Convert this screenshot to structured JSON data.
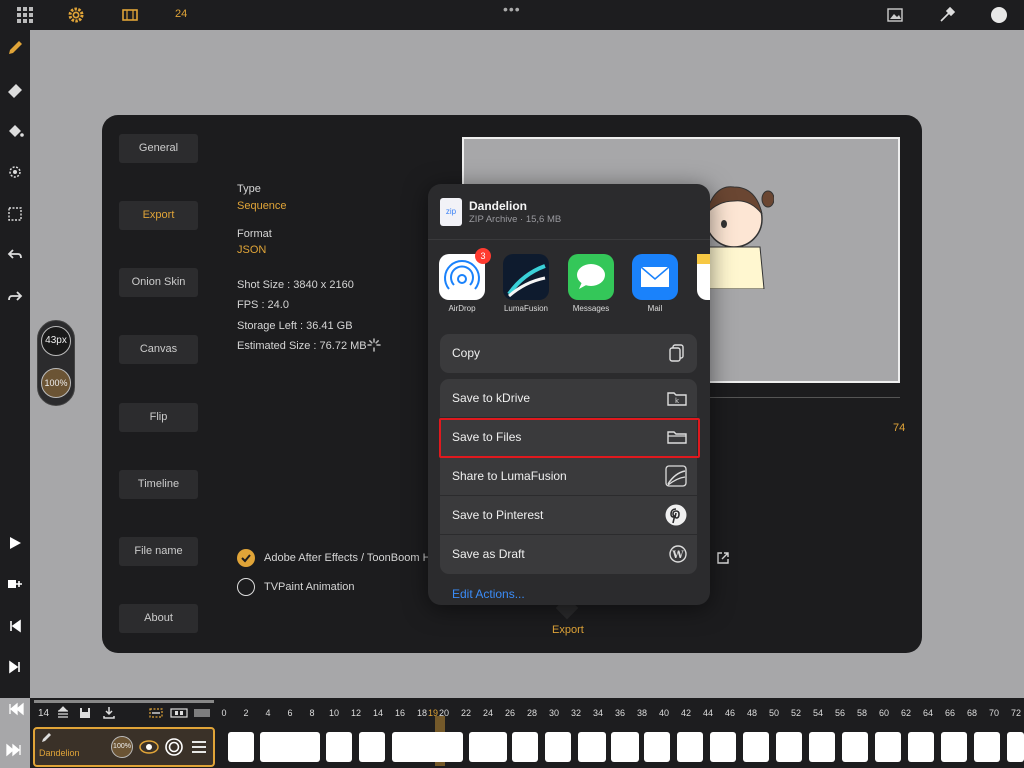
{
  "top_bar": {
    "frame_count": "24",
    "more_dots": "•••",
    "icons": [
      "grid-icon",
      "gear-icon",
      "film-icon",
      "image-icon",
      "eyedropper-icon",
      "color-swatch-icon"
    ]
  },
  "left_toolbar": {
    "tools": [
      "pencil-icon",
      "eraser-icon",
      "fill-bucket-icon",
      "lasso-icon",
      "selection-icon",
      "undo-icon",
      "redo-icon",
      "play-icon",
      "add-frame-icon",
      "first-frame-icon",
      "next-frame-icon",
      "skip-start-icon",
      "skip-end-icon"
    ],
    "brush_size": "43px",
    "opacity": "100%"
  },
  "settings": {
    "nav": [
      "General",
      "Export",
      "Onion Skin",
      "Canvas",
      "Flip",
      "Timeline",
      "File name",
      "About"
    ],
    "active_nav": "Export",
    "type_label": "Type",
    "type_value": "Sequence",
    "format_label": "Format",
    "format_value": "JSON",
    "shot_size": "Shot Size :  3840 x 2160",
    "fps": "FPS :  24.0",
    "storage_left": "Storage Left : 36.41 GB",
    "estimated_size": "Estimated Size : 76.72 MB",
    "slider_value": "74",
    "options": [
      {
        "label": "Adobe After Effects / ToonBoom H",
        "selected": true
      },
      {
        "label": "TVPaint Animation",
        "selected": false
      }
    ],
    "export_label": "Export"
  },
  "share_sheet": {
    "file_name": "Dandelion",
    "file_info": "ZIP Archive · 15,6 MB",
    "file_icon_text": "zip",
    "apps": [
      {
        "name": "AirDrop",
        "badge": "3",
        "color": "#ffffff"
      },
      {
        "name": "LumaFusion",
        "badge": null,
        "color": "#0e1b2e"
      },
      {
        "name": "Messages",
        "badge": null,
        "color": "#34c759"
      },
      {
        "name": "Mail",
        "badge": null,
        "color": "#1a82fb"
      }
    ],
    "actions": [
      {
        "label": "Copy",
        "icon": "copy-icon"
      },
      {
        "label": "Save to kDrive",
        "icon": "kdrive-folder-icon"
      },
      {
        "label": "Save to Files",
        "icon": "folder-icon",
        "highlighted": true
      },
      {
        "label": "Share to LumaFusion",
        "icon": "lumafusion-icon"
      },
      {
        "label": "Save to Pinterest",
        "icon": "pinterest-icon"
      },
      {
        "label": "Save as Draft",
        "icon": "wordpress-icon"
      }
    ],
    "edit_actions": "Edit Actions..."
  },
  "timeline": {
    "frame_number": "14",
    "ticks": [
      "0",
      "2",
      "4",
      "6",
      "8",
      "10",
      "12",
      "14",
      "16",
      "18",
      "19",
      "20",
      "22",
      "24",
      "26",
      "28",
      "30",
      "32",
      "34",
      "36",
      "38",
      "40",
      "42",
      "44",
      "46",
      "48",
      "50",
      "52",
      "54",
      "56",
      "58",
      "60",
      "62",
      "64",
      "66",
      "68",
      "70",
      "72"
    ],
    "current_frame": "19",
    "layer_name": "Dandelion",
    "layer_opacity": "100%"
  },
  "colors": {
    "accent": "#e0a438",
    "highlight_box": "#e0191e",
    "link": "#3b8cf7"
  }
}
